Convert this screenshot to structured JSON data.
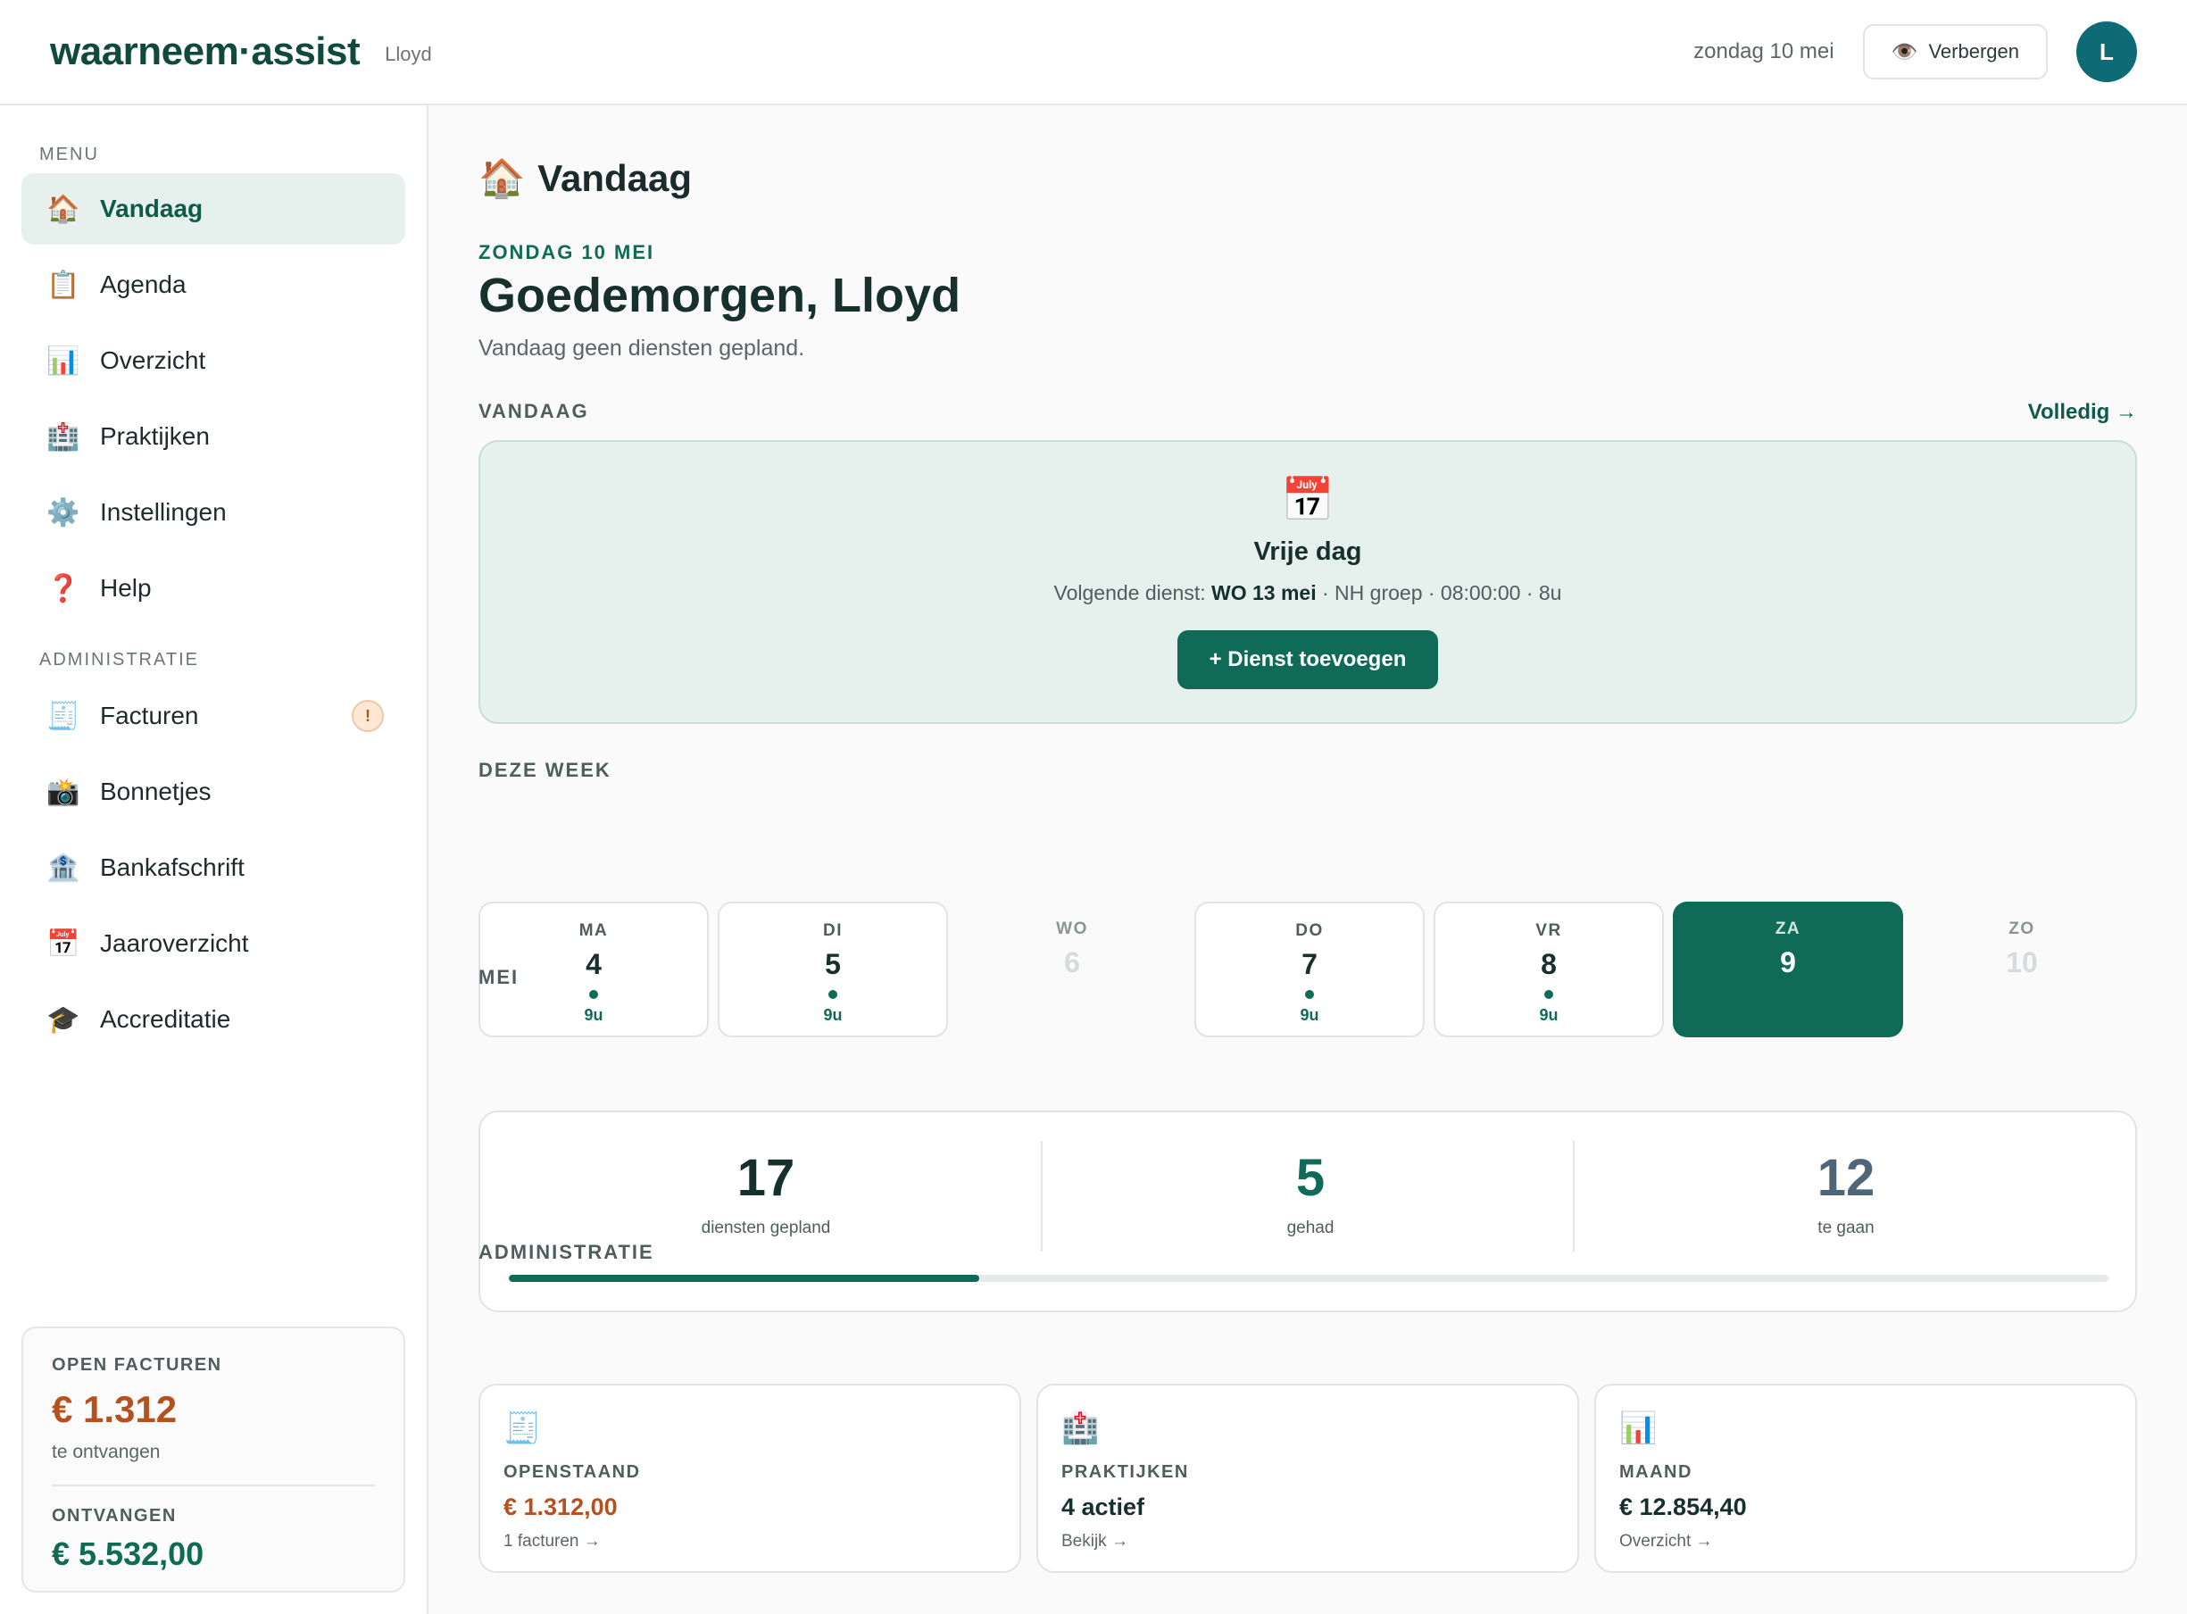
{
  "header": {
    "logo": "waarneem·assist",
    "user_name": "Lloyd",
    "date": "zondag 10 mei",
    "hide_icon": "eye-icon",
    "hide_label": "Verbergen",
    "avatar_initial": "L"
  },
  "sidebar": {
    "menu_heading": "MENU",
    "admin_heading": "ADMINISTRATIE",
    "menu_items": [
      {
        "icon": "house-icon",
        "glyph": "🏠",
        "label": "Vandaag",
        "active": true
      },
      {
        "icon": "clipboard-icon",
        "glyph": "📋",
        "label": "Agenda"
      },
      {
        "icon": "bar-chart-icon",
        "glyph": "📊",
        "label": "Overzicht"
      },
      {
        "icon": "hospital-icon",
        "glyph": "🏥",
        "label": "Praktijken"
      },
      {
        "icon": "gear-icon",
        "glyph": "⚙️",
        "label": "Instellingen"
      },
      {
        "icon": "question-icon",
        "glyph": "❓",
        "label": "Help"
      }
    ],
    "admin_items": [
      {
        "icon": "receipt-icon",
        "glyph": "🧾",
        "label": "Facturen",
        "badge": "!"
      },
      {
        "icon": "camera-icon",
        "glyph": "📸",
        "label": "Bonnetjes"
      },
      {
        "icon": "bank-icon",
        "glyph": "🏦",
        "label": "Bankafschrift"
      },
      {
        "icon": "calendar-icon",
        "glyph": "📅",
        "label": "Jaaroverzicht"
      },
      {
        "icon": "graduation-cap-icon",
        "glyph": "🎓",
        "label": "Accreditatie"
      }
    ],
    "summary": {
      "open_label": "OPEN FACTUREN",
      "open_value": "€ 1.312",
      "open_sub": "te ontvangen",
      "received_label": "ONTVANGEN",
      "received_value": "€ 5.532,00"
    }
  },
  "main": {
    "title_icon": "house-icon",
    "title_glyph": "🏠",
    "title": "Vandaag",
    "date_eyebrow": "ZONDAG 10 MEI",
    "greeting": "Goedemorgen, Lloyd",
    "greeting_sub": "Vandaag geen diensten gepland.",
    "today_section": "VANDAAG",
    "full_link": "Volledig →",
    "today_card": {
      "icon": "calendar-icon",
      "glyph": "📅",
      "title": "Vrije dag",
      "next_prefix": "Volgende dienst: ",
      "next_day": "WO 13 mei",
      "next_suffix": " · NH groep · 08:00:00 · 8u",
      "add_button": "+ Dienst toevoegen"
    },
    "week_section": "DEZE WEEK",
    "week": [
      {
        "name": "MA",
        "num": "4",
        "hours": "9u",
        "state": "work"
      },
      {
        "name": "DI",
        "num": "5",
        "hours": "9u",
        "state": "work"
      },
      {
        "name": "WO",
        "num": "6",
        "hours": "",
        "state": "off"
      },
      {
        "name": "DO",
        "num": "7",
        "hours": "9u",
        "state": "work"
      },
      {
        "name": "VR",
        "num": "8",
        "hours": "9u",
        "state": "work"
      },
      {
        "name": "ZA",
        "num": "9",
        "hours": "",
        "state": "today"
      },
      {
        "name": "ZO",
        "num": "10",
        "hours": "",
        "state": "off"
      }
    ],
    "month_section": "MEI",
    "month": {
      "planned_value": "17",
      "planned_label": "diensten gepland",
      "done_value": "5",
      "done_label": "gehad",
      "todo_value": "12",
      "todo_label": "te gaan",
      "progress_fraction": 0.294
    },
    "admin_section": "ADMINISTRATIE",
    "admin_cards": [
      {
        "icon": "receipt-icon",
        "glyph": "🧾",
        "label": "OPENSTAAND",
        "value": "€ 1.312,00",
        "link": "1 facturen →",
        "warn": true
      },
      {
        "icon": "hospital-icon",
        "glyph": "🏥",
        "label": "PRAKTIJKEN",
        "value": "4 actief",
        "link": "Bekijk →"
      },
      {
        "icon": "bar-chart-icon",
        "glyph": "📊",
        "label": "MAAND",
        "value": "€ 12.854,40",
        "link": "Overzicht →"
      }
    ]
  },
  "colors": {
    "brand": "#0f6b57",
    "brand_dark": "#0f4a3c",
    "warn": "#b3521e",
    "accent_bg": "#e6f0ec",
    "todo_stat": "#4f6578"
  }
}
